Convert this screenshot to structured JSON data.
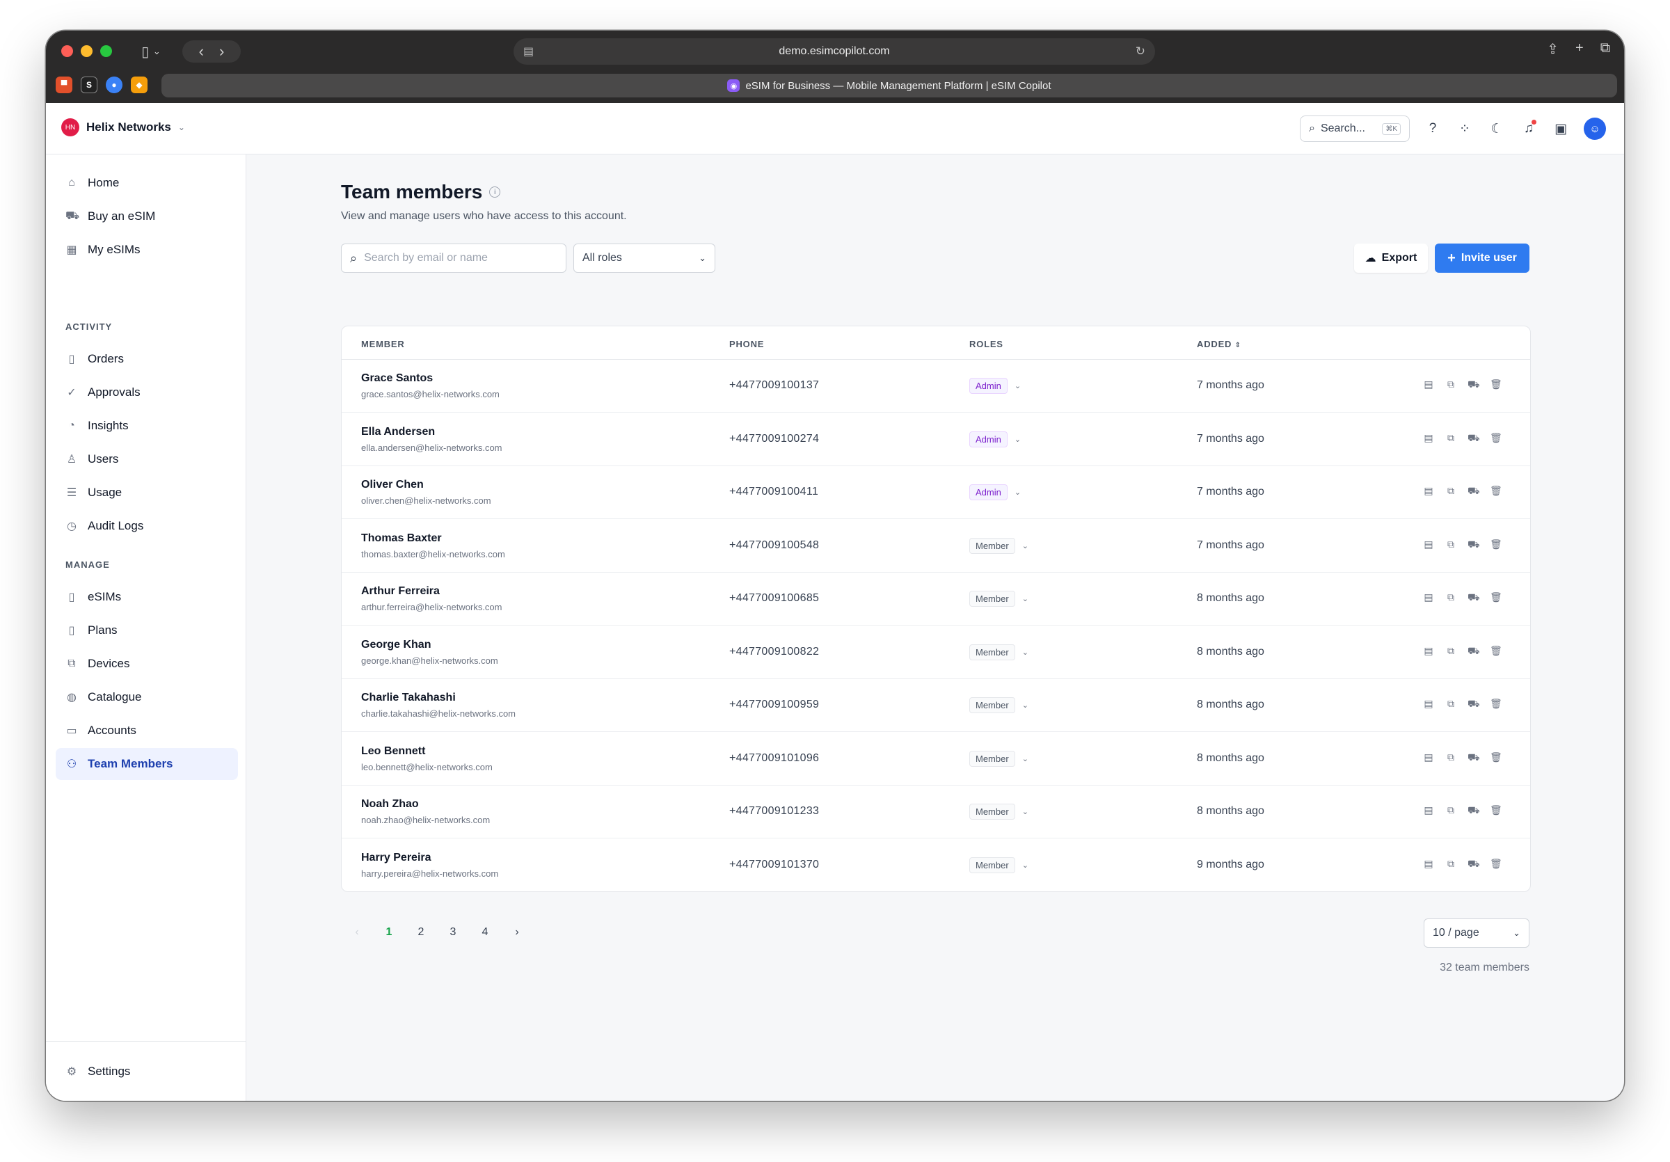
{
  "browser": {
    "url": "demo.esimcopilot.com",
    "tab_title": "eSIM for Business — Mobile Management Platform | eSIM Copilot"
  },
  "header": {
    "org_initials": "HN",
    "org_name": "Helix Networks",
    "search_label": "Search...",
    "search_shortcut": "⌘K"
  },
  "sidebar": {
    "top": [
      {
        "label": "Home",
        "icon": "home-icon"
      },
      {
        "label": "Buy an eSIM",
        "icon": "cart-icon"
      },
      {
        "label": "My eSIMs",
        "icon": "qr-icon"
      }
    ],
    "activity_heading": "ACTIVITY",
    "activity": [
      {
        "label": "Orders",
        "icon": "document-icon"
      },
      {
        "label": "Approvals",
        "icon": "check-circle-icon"
      },
      {
        "label": "Insights",
        "icon": "pie-chart-icon"
      },
      {
        "label": "Users",
        "icon": "user-icon"
      },
      {
        "label": "Usage",
        "icon": "database-icon"
      },
      {
        "label": "Audit Logs",
        "icon": "clock-icon"
      }
    ],
    "manage_heading": "MANAGE",
    "manage": [
      {
        "label": "eSIMs",
        "icon": "document-icon"
      },
      {
        "label": "Plans",
        "icon": "document-icon"
      },
      {
        "label": "Devices",
        "icon": "devices-icon"
      },
      {
        "label": "Catalogue",
        "icon": "globe-icon"
      },
      {
        "label": "Accounts",
        "icon": "briefcase-icon"
      },
      {
        "label": "Team Members",
        "icon": "team-icon",
        "active": true
      }
    ],
    "settings_label": "Settings"
  },
  "page": {
    "title": "Team members",
    "subtitle": "View and manage users who have access to this account.",
    "search_placeholder": "Search by email or name",
    "roles_filter": "All roles",
    "export_label": "Export",
    "invite_label": "Invite user"
  },
  "table": {
    "columns": [
      "MEMBER",
      "PHONE",
      "ROLES",
      "ADDED"
    ],
    "rows": [
      {
        "name": "Grace Santos",
        "email": "grace.santos@helix-networks.com",
        "phone": "+4477009100137",
        "role": "Admin",
        "added": "7 months ago"
      },
      {
        "name": "Ella Andersen",
        "email": "ella.andersen@helix-networks.com",
        "phone": "+4477009100274",
        "role": "Admin",
        "added": "7 months ago"
      },
      {
        "name": "Oliver Chen",
        "email": "oliver.chen@helix-networks.com",
        "phone": "+4477009100411",
        "role": "Admin",
        "added": "7 months ago"
      },
      {
        "name": "Thomas Baxter",
        "email": "thomas.baxter@helix-networks.com",
        "phone": "+4477009100548",
        "role": "Member",
        "added": "7 months ago"
      },
      {
        "name": "Arthur Ferreira",
        "email": "arthur.ferreira@helix-networks.com",
        "phone": "+4477009100685",
        "role": "Member",
        "added": "8 months ago"
      },
      {
        "name": "George Khan",
        "email": "george.khan@helix-networks.com",
        "phone": "+4477009100822",
        "role": "Member",
        "added": "8 months ago"
      },
      {
        "name": "Charlie Takahashi",
        "email": "charlie.takahashi@helix-networks.com",
        "phone": "+4477009100959",
        "role": "Member",
        "added": "8 months ago"
      },
      {
        "name": "Leo Bennett",
        "email": "leo.bennett@helix-networks.com",
        "phone": "+4477009101096",
        "role": "Member",
        "added": "8 months ago"
      },
      {
        "name": "Noah Zhao",
        "email": "noah.zhao@helix-networks.com",
        "phone": "+4477009101233",
        "role": "Member",
        "added": "8 months ago"
      },
      {
        "name": "Harry Pereira",
        "email": "harry.pereira@helix-networks.com",
        "phone": "+4477009101370",
        "role": "Member",
        "added": "9 months ago"
      }
    ]
  },
  "pagination": {
    "pages": [
      "1",
      "2",
      "3",
      "4"
    ],
    "current": "1",
    "page_size": "10 / page",
    "total": "32 team members"
  },
  "colors": {
    "accent": "#2f7bf0",
    "admin_badge": "#7e22ce",
    "current_page": "#16a34a"
  }
}
